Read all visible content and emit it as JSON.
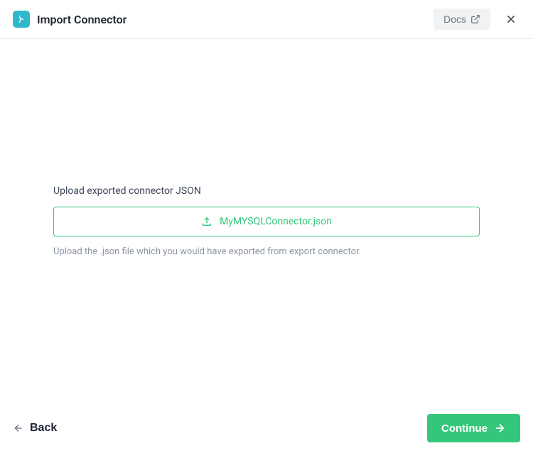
{
  "header": {
    "title": "Import Connector",
    "docs_label": "Docs"
  },
  "content": {
    "upload_label": "Upload exported connector JSON",
    "filename": "MyMYSQLConnector.json",
    "help_text": "Upload the .json file which you would have exported from export connector."
  },
  "footer": {
    "back_label": "Back",
    "continue_label": "Continue"
  }
}
